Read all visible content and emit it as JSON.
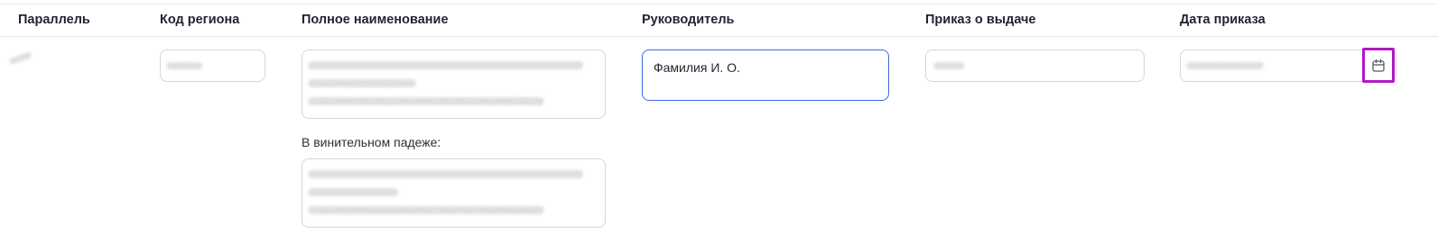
{
  "table": {
    "headers": {
      "parallel": "Параллель",
      "region_code": "Код региона",
      "full_name": "Полное наименование",
      "head": "Руководитель",
      "issue_order": "Приказ о выдаче",
      "order_date": "Дата приказа"
    },
    "row": {
      "head_value": "Фамилия И. О.",
      "accusative_label": "В винительном падеже:"
    }
  },
  "icons": {
    "calendar": "calendar-icon"
  },
  "colors": {
    "focus_border": "#3b68e8",
    "highlight": "#b018c6",
    "border": "#d3d6dc"
  }
}
